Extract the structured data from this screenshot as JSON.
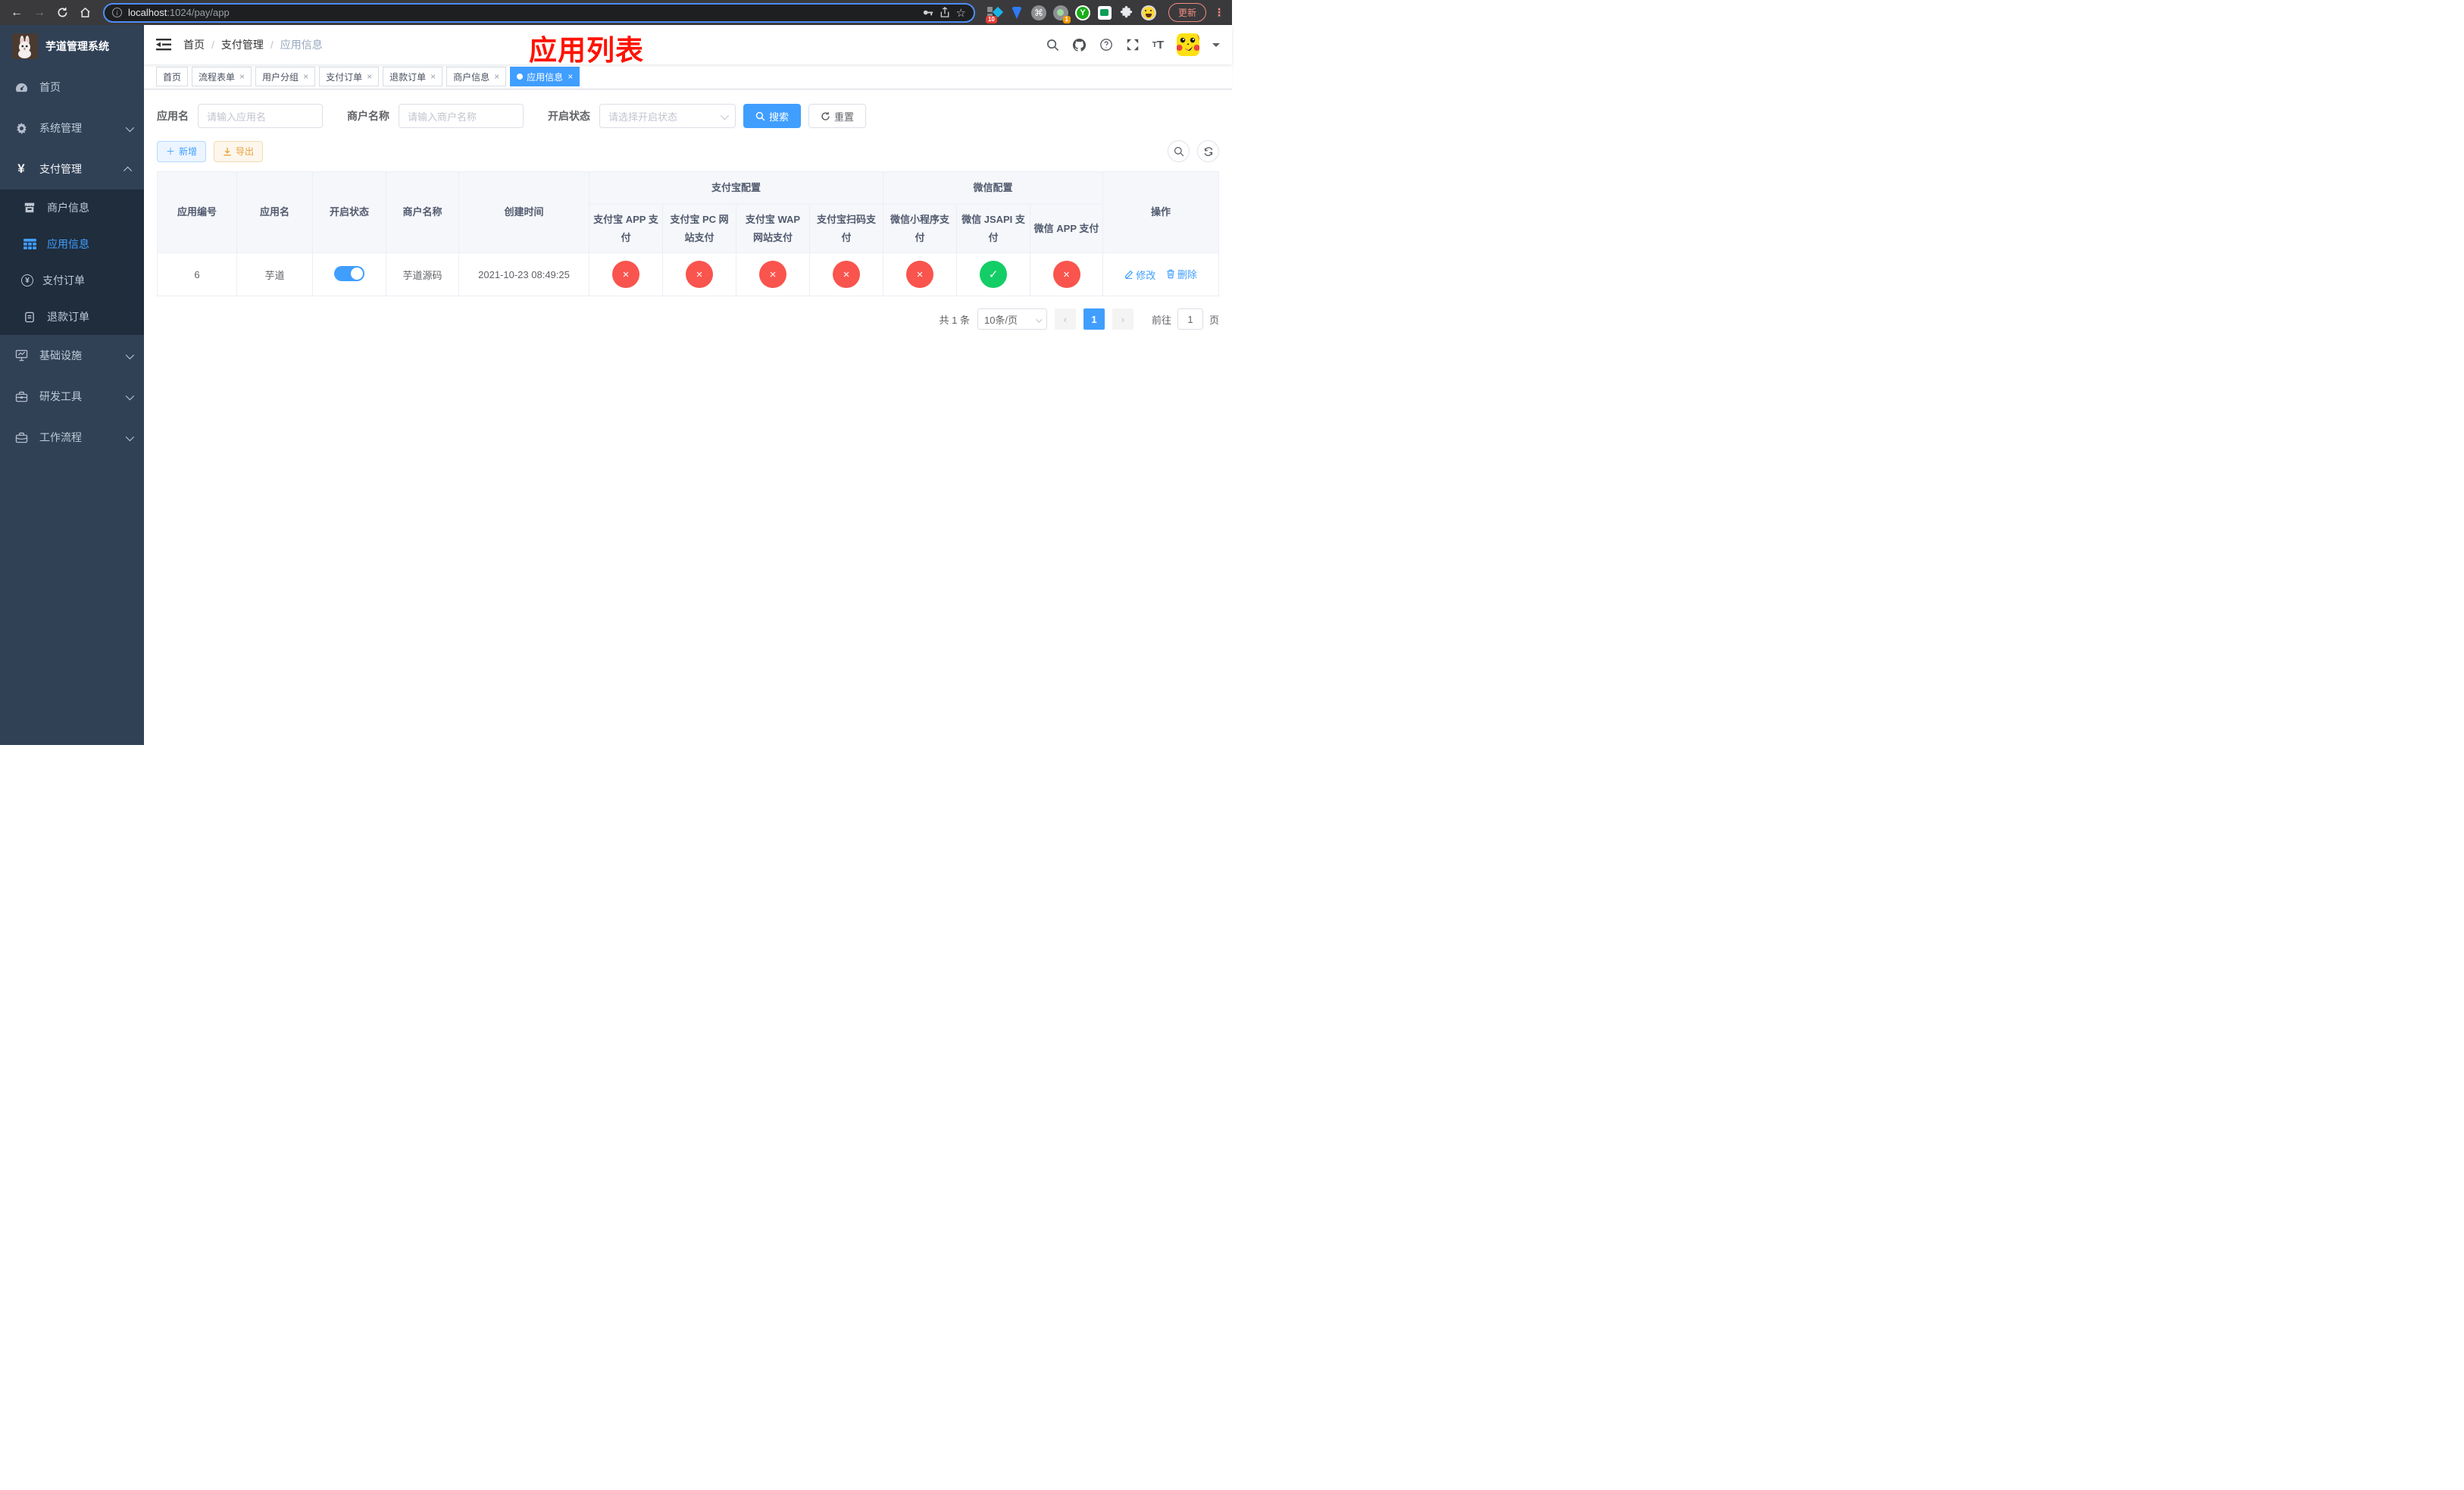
{
  "browser": {
    "url_host": "localhost",
    "url_rest": ":1024/pay/app",
    "update_label": "更新",
    "ext_badge_blue_diamond": "10",
    "ext_badge_green_dot": "1",
    "ext_y_letter": "Y",
    "ext_command_glyph": "⌘"
  },
  "sidebar": {
    "title": "芋道管理系统",
    "items": {
      "home": "首页",
      "system": "系统管理",
      "payment": "支付管理",
      "infra": "基础设施",
      "devtools": "研发工具",
      "workflow": "工作流程"
    },
    "payment_children": {
      "merchant": "商户信息",
      "app": "应用信息",
      "pay_order": "支付订单",
      "refund_order": "退款订单"
    }
  },
  "navbar": {
    "breadcrumb": [
      "首页",
      "支付管理",
      "应用信息"
    ],
    "separator": "/",
    "annotation_title": "应用列表"
  },
  "tabs": [
    {
      "label": "首页"
    },
    {
      "label": "流程表单"
    },
    {
      "label": "用户分组"
    },
    {
      "label": "支付订单"
    },
    {
      "label": "退款订单"
    },
    {
      "label": "商户信息"
    },
    {
      "label": "应用信息"
    }
  ],
  "filters": {
    "app_name_label": "应用名",
    "app_name_placeholder": "请输入应用名",
    "merchant_label": "商户名称",
    "merchant_placeholder": "请输入商户名称",
    "status_label": "开启状态",
    "status_placeholder": "请选择开启状态",
    "search_label": "搜索",
    "reset_label": "重置"
  },
  "toolbar": {
    "add_label": "新增",
    "export_label": "导出"
  },
  "table": {
    "columns": {
      "app_id": "应用编号",
      "app_name": "应用名",
      "status": "开启状态",
      "merchant": "商户名称",
      "created": "创建时间",
      "group_alipay": "支付宝配置",
      "group_wechat": "微信配置",
      "actions": "操作"
    },
    "sub_columns": [
      "支付宝 APP 支付",
      "支付宝 PC 网站支付",
      "支付宝 WAP 网站支付",
      "支付宝扫码支付",
      "微信小程序支付",
      "微信 JSAPI 支付",
      "微信 APP 支付"
    ],
    "row": {
      "app_id": "6",
      "app_name": "芋道",
      "status_on": true,
      "merchant": "芋道源码",
      "created": "2021-10-23 08:49:25",
      "pay_channels": [
        "no",
        "no",
        "no",
        "no",
        "no",
        "yes",
        "no"
      ],
      "edit_label": "修改",
      "delete_label": "删除"
    }
  },
  "pagination": {
    "total_text": "共 1 条",
    "page_size_text": "10条/页",
    "current_page": "1",
    "goto_label": "前往",
    "goto_value": "1",
    "goto_suffix": "页"
  },
  "icons": {
    "close_x": "×",
    "check": "✓",
    "cross": "×",
    "yen": "¥",
    "plus": "＋",
    "prev_arrow": "‹",
    "next_arrow": "›",
    "dots_vertical": "⋮",
    "star": "☆"
  },
  "colors": {
    "accent_blue": "#409eff",
    "success_green": "#13ce66",
    "danger_red": "#f9544d",
    "annotation_red": "#ff1200",
    "export_orange": "#e6a23c",
    "sidebar_bg": "#304156",
    "submenu_bg": "#1f2d3d",
    "chrome_update_salmon": "#f28b82"
  }
}
